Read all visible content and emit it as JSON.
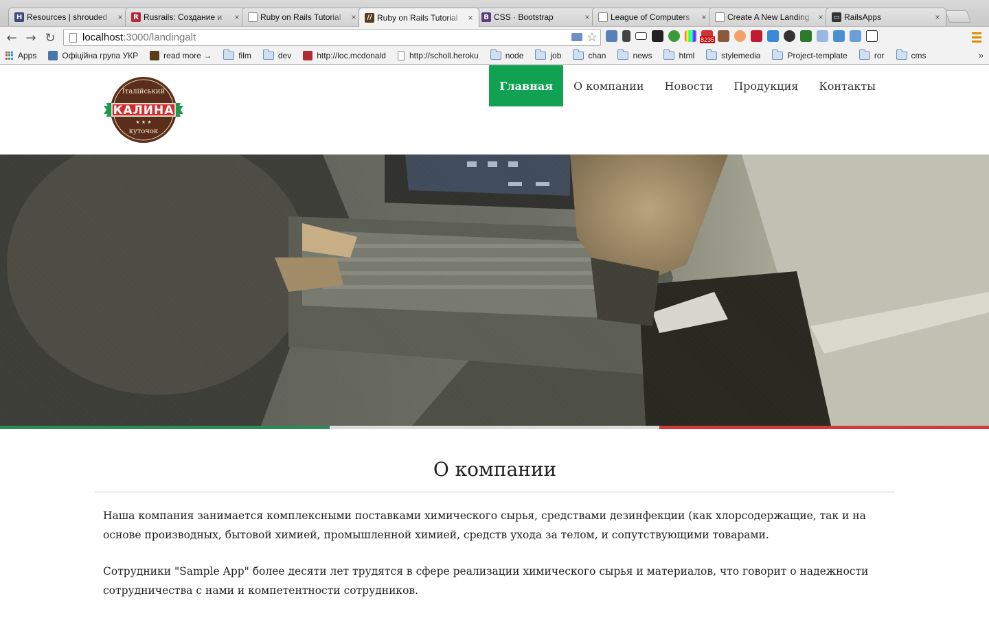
{
  "browser": {
    "tabs": [
      {
        "title": "Resources | shrouded",
        "favicon": "H",
        "favicon_color": "#3b4a7a"
      },
      {
        "title": "Rusrails: Создание и",
        "favicon": "R",
        "favicon_color": "#b02a37"
      },
      {
        "title": "Ruby on Rails Tutorial",
        "favicon": "",
        "favicon_color": "#ffffff"
      },
      {
        "title": "Ruby on Rails Tutorial",
        "favicon": "//",
        "favicon_color": "#5a3b1a"
      },
      {
        "title": "CSS · Bootstrap",
        "favicon": "B",
        "favicon_color": "#563d7c"
      },
      {
        "title": "League of Computers",
        "favicon": "",
        "favicon_color": "#ffffff"
      },
      {
        "title": "Create A New Landing",
        "favicon": "",
        "favicon_color": "#ffffff"
      },
      {
        "title": "RailsApps",
        "favicon": "▭",
        "favicon_color": "#333333"
      }
    ],
    "active_tab_index": 3,
    "url_host": "localhost",
    "url_path": ":3000/landingalt",
    "bookmarks": [
      {
        "label": "Apps",
        "icon": "apps-icon"
      },
      {
        "label": "Офіційна група УКР",
        "icon": "vk-icon"
      },
      {
        "label": "read more →",
        "icon": "readmore-icon"
      },
      {
        "label": "film",
        "icon": "folder-icon"
      },
      {
        "label": "dev",
        "icon": "folder-icon"
      },
      {
        "label": "http://loc.mcdonald",
        "icon": "mcd-icon"
      },
      {
        "label": "http://scholl.heroku",
        "icon": "page-icon"
      },
      {
        "label": "node",
        "icon": "folder-icon"
      },
      {
        "label": "job",
        "icon": "folder-icon"
      },
      {
        "label": "chan",
        "icon": "folder-icon"
      },
      {
        "label": "news",
        "icon": "folder-icon"
      },
      {
        "label": "html",
        "icon": "folder-icon"
      },
      {
        "label": "stylemedia",
        "icon": "folder-icon"
      },
      {
        "label": "Project-template",
        "icon": "folder-icon"
      },
      {
        "label": "ror",
        "icon": "folder-icon"
      },
      {
        "label": "cms",
        "icon": "folder-icon"
      }
    ],
    "bookmarks_more": "»",
    "extension_badge": "8235"
  },
  "site": {
    "logo": {
      "top_text": "Італійський",
      "main_text": "КАЛИНА",
      "bottom_text": "куточок"
    },
    "nav": [
      {
        "label": "Главная",
        "active": true
      },
      {
        "label": "О компании",
        "active": false
      },
      {
        "label": "Новости",
        "active": false
      },
      {
        "label": "Продукция",
        "active": false
      },
      {
        "label": "Контакты",
        "active": false
      }
    ],
    "colors": {
      "accent_green": "#10a153",
      "flag_green": "#2e8b57",
      "flag_white": "#dcdcdc",
      "flag_red": "#d33a3a"
    },
    "about": {
      "title": "О компании",
      "paragraph_1": "Наша компания занимается комплексными поставками химического сырья, средствами дезинфекции (как хлорсодержащие, так и на основе производных, бытовой химией, промышленной химией, средств ухода за телом, и сопутствующими товарами.",
      "paragraph_2": "Сотрудники \"Sample App\" более десяти лет трудятся в сфере реализации химического сырья и материалов, что говорит о надежности сотрудничества с нами и компетентности сотрудников."
    }
  }
}
